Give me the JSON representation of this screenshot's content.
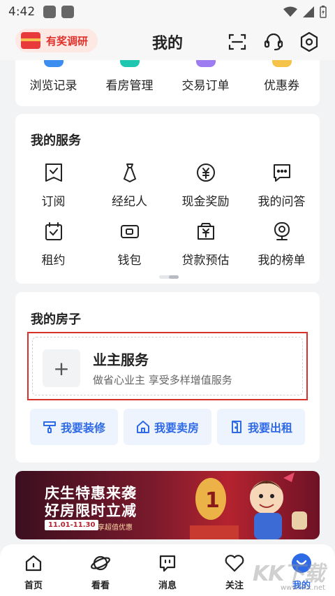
{
  "status_bar": {
    "time": "4:42"
  },
  "header": {
    "survey_label": "有奖调研",
    "title": "我的"
  },
  "quick_links": [
    {
      "label": "浏览记录",
      "icon": "history-icon",
      "color": "#3b8ef0"
    },
    {
      "label": "看房管理",
      "icon": "house-view-icon",
      "color": "#1fc7b0"
    },
    {
      "label": "交易订单",
      "icon": "order-icon",
      "color": "#9c7cf0"
    },
    {
      "label": "优惠券",
      "icon": "coupon-icon",
      "color": "#f6c34a"
    }
  ],
  "services": {
    "title": "我的服务",
    "items": [
      {
        "label": "订阅",
        "icon": "subscribe-icon"
      },
      {
        "label": "经纪人",
        "icon": "agent-icon"
      },
      {
        "label": "现金奖励",
        "icon": "cash-reward-icon"
      },
      {
        "label": "我的问答",
        "icon": "qa-icon"
      },
      {
        "label": "租约",
        "icon": "lease-icon"
      },
      {
        "label": "钱包",
        "icon": "wallet-icon"
      },
      {
        "label": "贷款预估",
        "icon": "loan-icon"
      },
      {
        "label": "我的榜单",
        "icon": "ranking-icon"
      }
    ]
  },
  "my_house": {
    "title": "我的房子",
    "owner_title": "业主服务",
    "owner_sub": "做省心业主 享受多样增值服务",
    "actions": [
      {
        "label": "我要装修",
        "icon": "renovate-icon"
      },
      {
        "label": "我要卖房",
        "icon": "sell-house-icon"
      },
      {
        "label": "我要出租",
        "icon": "rent-out-icon"
      }
    ]
  },
  "banner": {
    "line1": "庆生特惠来袭",
    "line2": "好房限时立减",
    "date": "11.01-11.30",
    "tag": "享超值优惠"
  },
  "tabbar": {
    "items": [
      {
        "label": "首页",
        "icon": "home-icon"
      },
      {
        "label": "看看",
        "icon": "planet-icon"
      },
      {
        "label": "消息",
        "icon": "message-icon"
      },
      {
        "label": "关注",
        "icon": "heart-icon"
      },
      {
        "label": "我的",
        "icon": "profile-icon"
      }
    ],
    "active_color": "#2f6ae6"
  },
  "watermark": {
    "text": "KK下载",
    "url": "www.kkx.net"
  }
}
